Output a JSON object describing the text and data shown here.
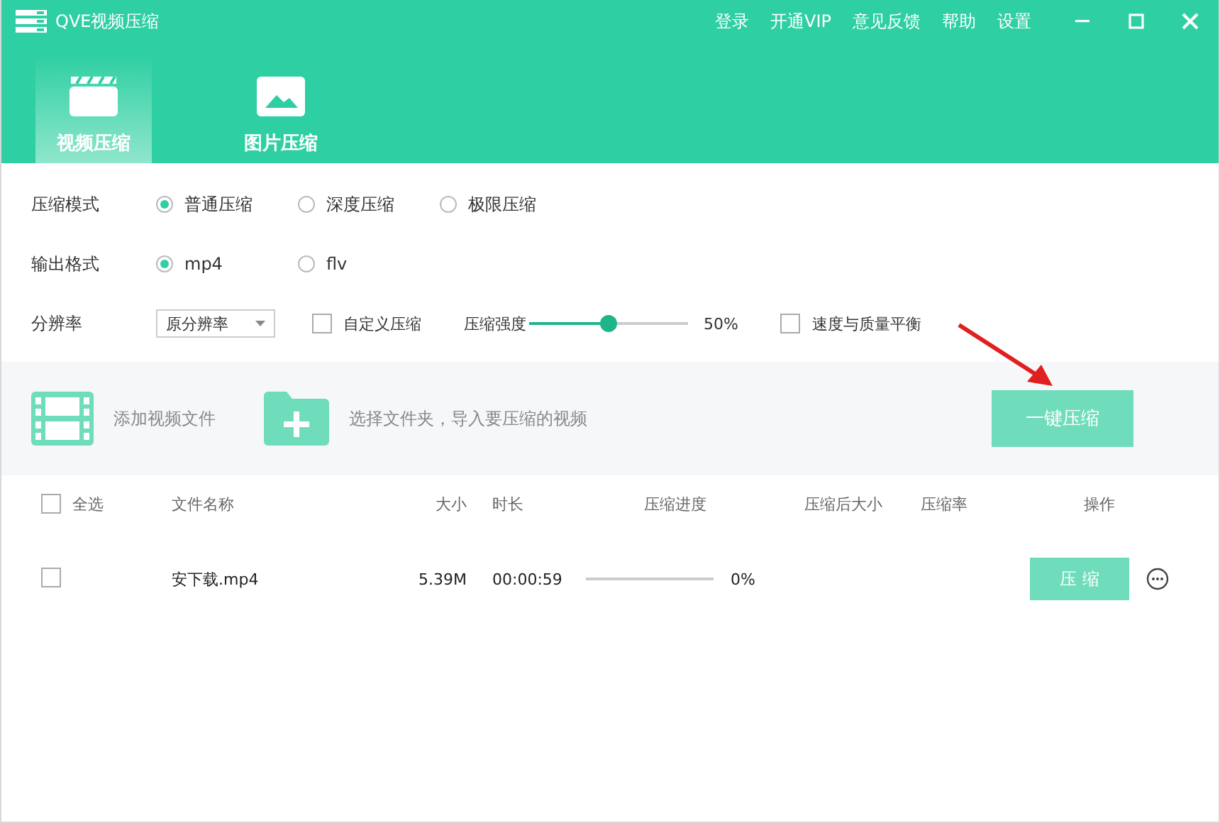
{
  "window": {
    "title": "QVE视频压缩"
  },
  "top_menu": [
    "登录",
    "开通VIP",
    "意见反馈",
    "帮助",
    "设置"
  ],
  "tabs": [
    {
      "label": "视频压缩",
      "kind": "video",
      "selected": true
    },
    {
      "label": "图片压缩",
      "kind": "image",
      "selected": false
    }
  ],
  "compress_mode": {
    "label": "压缩模式",
    "options": [
      {
        "label": "普通压缩",
        "selected": true
      },
      {
        "label": "深度压缩",
        "selected": false
      },
      {
        "label": "极限压缩",
        "selected": false
      }
    ]
  },
  "output_format": {
    "label": "输出格式",
    "options": [
      {
        "label": "mp4",
        "selected": true
      },
      {
        "label": "flv",
        "selected": false
      }
    ]
  },
  "resolution": {
    "label": "分辨率",
    "value": "原分辨率"
  },
  "custom_compress": {
    "label": "自定义压缩",
    "checked": false
  },
  "strength": {
    "label": "压缩强度",
    "level": 0.5,
    "reading": "50%"
  },
  "balance": {
    "label": "速度与质量平衡",
    "checked": false
  },
  "toolbar": {
    "add_video": "添加视频文件",
    "choose_folder": "选择文件夹，导入要压缩的视频",
    "compress_all": "一键压缩"
  },
  "table": {
    "select_all": {
      "label": "全选",
      "checked": false
    },
    "columns": [
      "文件名称",
      "大小",
      "时长",
      "压缩进度",
      "压缩后大小",
      "压缩率",
      "操作"
    ],
    "rows": [
      {
        "checked": false,
        "name": "安下载.mp4",
        "size": "5.39M",
        "duration": "00:00:59",
        "level": 0,
        "progress": "0%",
        "action": "压 缩"
      }
    ]
  }
}
